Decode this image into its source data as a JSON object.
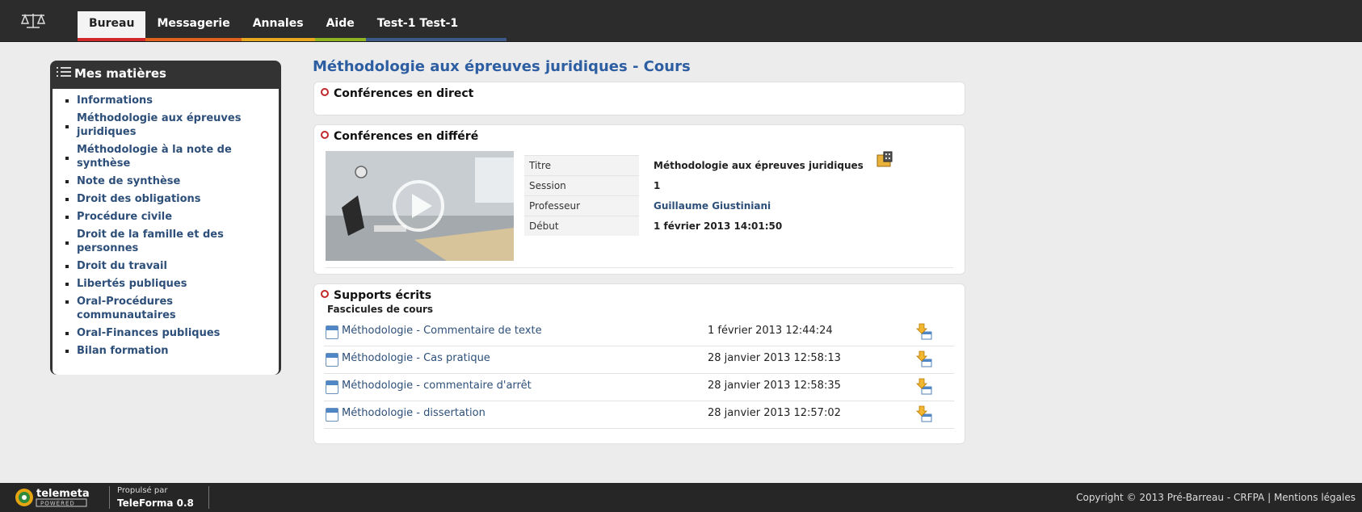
{
  "nav": {
    "tabs": [
      {
        "label": "Bureau",
        "color": "#d0282b",
        "active": true
      },
      {
        "label": "Messagerie",
        "color": "#e1621d"
      },
      {
        "label": "Annales",
        "color": "#e8a81e"
      },
      {
        "label": "Aide",
        "color": "#8fb321"
      },
      {
        "label": "Test-1 Test-1",
        "color": "#3b5a87"
      }
    ]
  },
  "sidebar": {
    "title": "Mes matières",
    "items": [
      "Informations",
      "Méthodologie aux épreuves juridiques",
      "Méthodologie à la note de synthèse",
      "Note de synthèse",
      "Droit des obligations",
      "Procédure civile",
      "Droit de la famille et des personnes",
      "Droit du travail",
      "Libertés publiques",
      "Oral-Procédures communautaires",
      "Oral-Finances publiques",
      "Bilan formation"
    ]
  },
  "main": {
    "title": "Méthodologie aux épreuves juridiques - Cours",
    "live": {
      "title": "Conférences en direct"
    },
    "recorded": {
      "title": "Conférences en différé",
      "rows": [
        {
          "label": "Titre",
          "value": "Méthodologie aux épreuves juridiques"
        },
        {
          "label": "Session",
          "value": "1"
        },
        {
          "label": "Professeur",
          "value": "Guillaume Giustiniani"
        },
        {
          "label": "Début",
          "value": "1 février 2013 14:01:50"
        }
      ]
    },
    "documents": {
      "title": "Supports écrits",
      "subtitle": "Fascicules de cours",
      "items": [
        {
          "name": "Méthodologie - Commentaire de texte",
          "date": "1 février 2013 12:44:24"
        },
        {
          "name": "Méthodologie - Cas pratique",
          "date": "28 janvier 2013 12:58:13"
        },
        {
          "name": "Méthodologie - commentaire d'arrêt",
          "date": "28 janvier 2013 12:58:35"
        },
        {
          "name": "Méthodologie - dissertation",
          "date": "28 janvier 2013 12:57:02"
        }
      ]
    }
  },
  "footer": {
    "logo_text": "telemeta",
    "logo_sub": "POWERED",
    "powered_label": "Propulsé par",
    "engine": "TeleForma 0.8",
    "copyright": "Copyright © 2013 Pré-Barreau - CRFPA | Mentions légales"
  },
  "icons": {
    "logo": "scales-icon",
    "menu": "list-icon",
    "play": "play-icon",
    "download": "download-icon",
    "document": "document-icon"
  }
}
